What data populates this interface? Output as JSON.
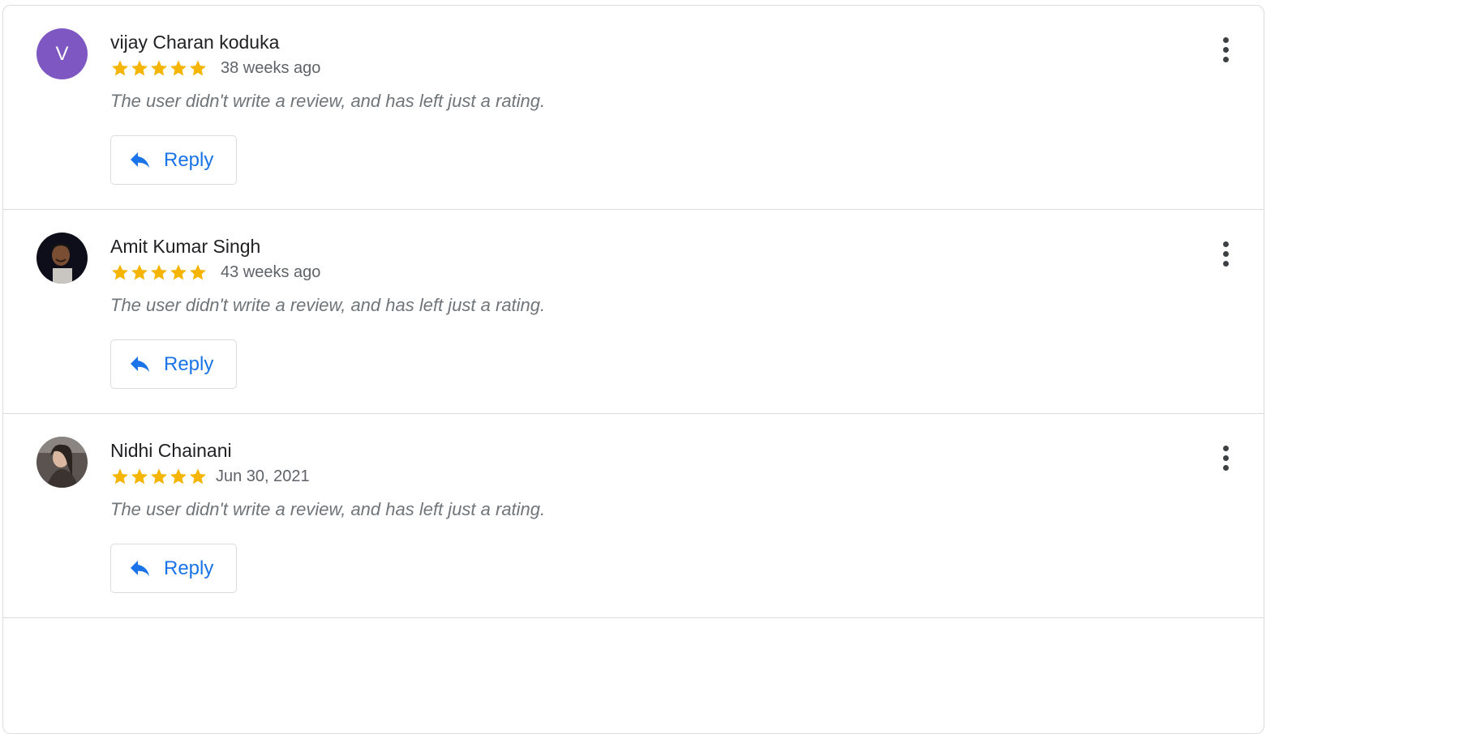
{
  "colors": {
    "star": "#f4b400",
    "accent": "#1a73e8",
    "avatar_letter_bg": "#7e57c2",
    "border": "#dadce0"
  },
  "icons": {
    "reply": "reply-icon",
    "more": "more-vert-icon",
    "star": "star-icon"
  },
  "reviews": [
    {
      "author": "vijay Charan koduka",
      "avatar_letter": "V",
      "rating": 5,
      "date": "38 weeks ago",
      "text": "The user didn't write a review, and has left just a rating.",
      "reply_label": "Reply"
    },
    {
      "author": "Amit Kumar Singh",
      "rating": 5,
      "date": "43 weeks ago",
      "text": "The user didn't write a review, and has left just a rating.",
      "reply_label": "Reply"
    },
    {
      "author": "Nidhi Chainani",
      "rating": 5,
      "date": "Jun 30, 2021",
      "text": "The user didn't write a review, and has left just a rating.",
      "reply_label": "Reply"
    }
  ]
}
